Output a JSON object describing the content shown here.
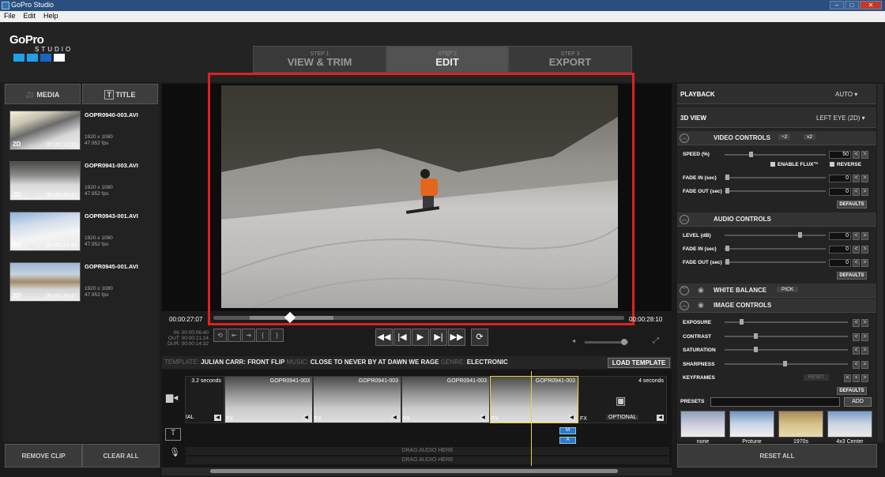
{
  "window": {
    "title": "GoPro Studio"
  },
  "menu": [
    "File",
    "Edit",
    "Help"
  ],
  "logo": {
    "brand": "GoPro",
    "sub": "STUDIO",
    "colors": [
      "#1fa0e8",
      "#1fa0e8",
      "#1766c4",
      "#ffffff"
    ]
  },
  "steps": [
    {
      "num": "STEP 1",
      "label": "VIEW & TRIM"
    },
    {
      "num": "STEP 2",
      "label": "EDIT"
    },
    {
      "num": "STEP 3",
      "label": "EXPORT"
    }
  ],
  "left_tabs": {
    "media": "MEDIA",
    "title": "TITLE"
  },
  "media": [
    {
      "name": "GOPR0940-003.AVI",
      "res": "1920 x 1080",
      "fps": "47.952 fps",
      "dim": "2D",
      "duration": "00:00:13:11"
    },
    {
      "name": "GOPR0941-003.AVI",
      "res": "1920 x 1080",
      "fps": "47.952 fps",
      "dim": "2D",
      "duration": "00:00:36:47"
    },
    {
      "name": "GOPR0943-001.AVI",
      "res": "1920 x 1080",
      "fps": "47.952 fps",
      "dim": "2D",
      "duration": "00:00:24:35"
    },
    {
      "name": "GOPR0945-001.AVI",
      "res": "1920 x 1080",
      "fps": "47.952 fps",
      "dim": "2D",
      "duration": "00:00:29:47"
    }
  ],
  "left_buttons": {
    "remove": "REMOVE CLIP",
    "clear": "CLEAR ALL"
  },
  "player": {
    "current_time": "00:00:27:07",
    "end_time": "00:00:28:10",
    "in": "IN: 00:00:06:40",
    "out": "OUT: 00:00:21:24",
    "dur": "DUR: 00:00:14:32",
    "scrub_progress": 0.19
  },
  "template": {
    "template_key": "TEMPLATE:",
    "template_value": "JULIAN CARR: FRONT FLIP",
    "music_key": "MUSIC:",
    "music_value": "CLOSE TO NEVER BY AT DAWN WE RAGE",
    "genre_key": "GENRE:",
    "genre_value": "ELECTRONIC",
    "load_button": "LOAD TEMPLATE"
  },
  "timeline": {
    "first_duration": "3.2 seconds",
    "first_suffix": "IAL",
    "clips": [
      "GOPR0941-003",
      "GOPR0941-003",
      "GOPR0941-003",
      "GOPR0941-003"
    ],
    "fx": "FX",
    "last_duration": "4 seconds",
    "optional": "OPTIONAL",
    "drag_audio_1": "DRAG AUDIO HERE",
    "drag_audio_2": "DRAG AUDIO HERE",
    "marker_m": "M",
    "marker_a": "A"
  },
  "right": {
    "playback_label": "PLAYBACK",
    "playback_value": "AUTO",
    "view3d_label": "3D VIEW",
    "view3d_value": "LEFT EYE (2D)",
    "video_controls": "VIDEO CONTROLS",
    "speed_half": "÷2",
    "speed_double": "x2",
    "speed_label": "SPEED (%)",
    "speed_value": "50",
    "enable_flux": "ENABLE FLUX™",
    "reverse": "REVERSE",
    "fade_in": "FADE IN (sec)",
    "fade_out": "FADE OUT (sec)",
    "fade_in_value": "0",
    "fade_out_value": "0",
    "defaults": "DEFAULTS",
    "audio_controls": "AUDIO CONTROLS",
    "level": "LEVEL (dB)",
    "level_value": "0",
    "a_fade_in_value": "0",
    "a_fade_out_value": "0",
    "white_balance": "WHITE BALANCE",
    "pick": "PICK",
    "image_controls": "IMAGE CONTROLS",
    "exposure": "EXPOSURE",
    "contrast": "CONTRAST",
    "saturation": "SATURATION",
    "sharpness": "SHARPNESS",
    "keyframes": "KEYFRAMES",
    "reset": "RESET",
    "presets_label": "PRESETS",
    "add": "ADD",
    "presets": [
      "none",
      "Protune",
      "1970s",
      "4x3 Center"
    ],
    "reset_all": "RESET ALL"
  }
}
